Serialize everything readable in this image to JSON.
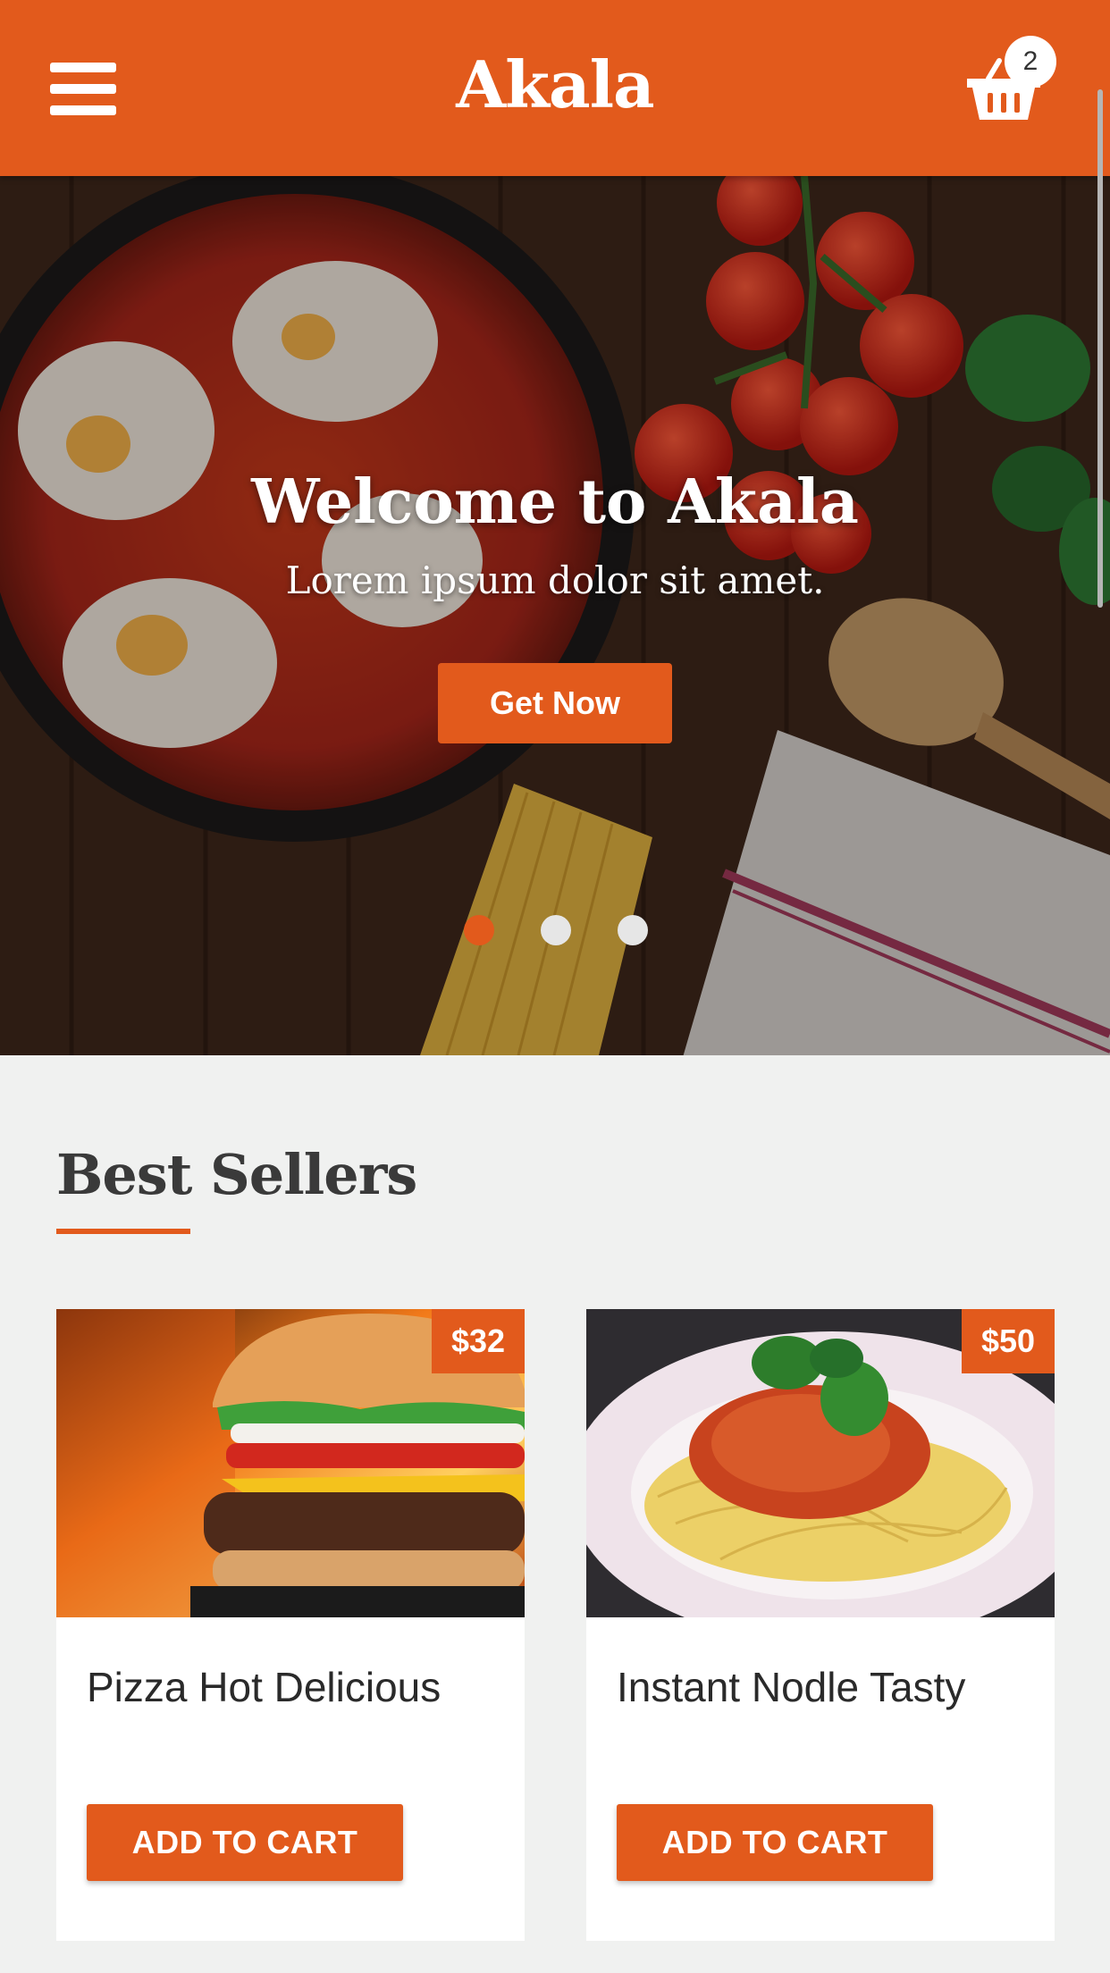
{
  "header": {
    "brand": "Akala",
    "cart_count": "2",
    "menu_icon": "hamburger-menu-icon",
    "cart_icon": "shopping-basket-icon"
  },
  "hero": {
    "title": "Welcome to Akala",
    "subtitle": "Lorem ipsum dolor sit amet.",
    "cta_label": "Get Now",
    "slides": 3,
    "active_slide": 1
  },
  "best_sellers": {
    "title": "Best Sellers",
    "items": [
      {
        "name": "Pizza Hot Delicious",
        "price": "$32",
        "button": "ADD TO CART"
      },
      {
        "name": "Instant Nodle Tasty",
        "price": "$50",
        "button": "ADD TO CART"
      }
    ]
  },
  "colors": {
    "accent": "#e25a1c",
    "background": "#f0f1f0",
    "card": "#ffffff"
  }
}
